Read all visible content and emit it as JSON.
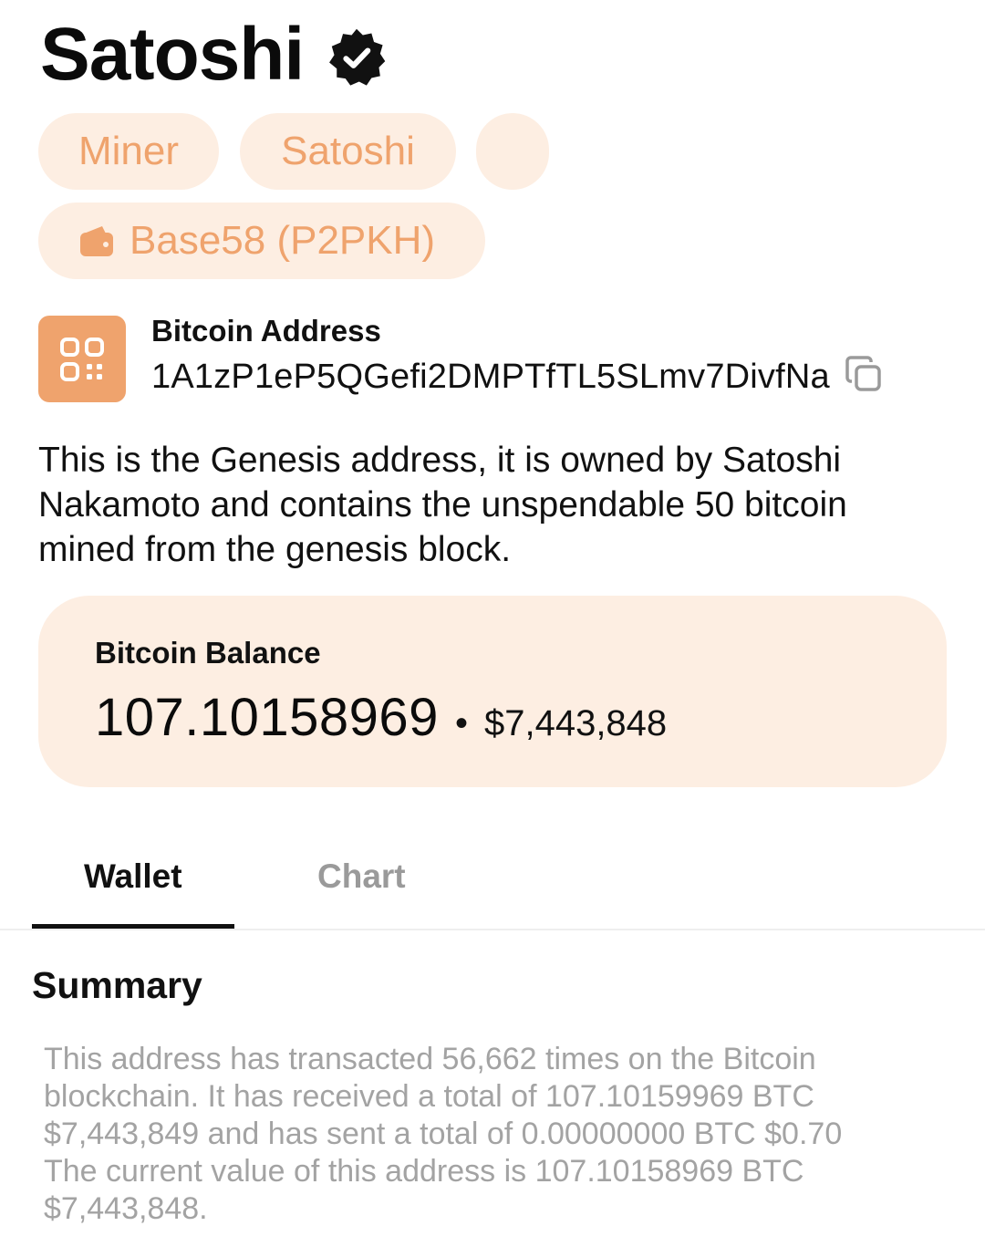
{
  "header": {
    "title": "Satoshi",
    "verified_icon": "verified-badge-icon"
  },
  "chips": {
    "miner": "Miner",
    "satoshi": "Satoshi",
    "address_type": "Base58 (P2PKH)",
    "address_type_icon": "wallet-icon"
  },
  "address": {
    "icon": "qr-code-icon",
    "label": "Bitcoin Address",
    "value": "1A1zP1eP5QGefi2DMPTfTL5SLmv7DivfNa",
    "copy_icon": "copy-icon"
  },
  "description": "This is the Genesis address, it is owned by Satoshi Nakamoto and contains the unspendable 50 bitcoin mined from the genesis block.",
  "balance": {
    "label": "Bitcoin Balance",
    "btc": "107.10158969",
    "separator": "•",
    "usd": "$7,443,848"
  },
  "tabs": [
    {
      "label": "Wallet",
      "active": true
    },
    {
      "label": "Chart",
      "active": false
    }
  ],
  "summary": {
    "title": "Summary",
    "text": "This address has transacted 56,662 times on the Bitcoin blockchain. It has received a total of 107.10159969 BTC $7,443,849 and has sent a total of 0.00000000 BTC $0.70 The current value of this address is 107.10158969 BTC $7,443,848."
  },
  "colors": {
    "accent": "#efa36d",
    "chip_bg": "#fdeee2",
    "muted_text": "#a3a3a3"
  }
}
